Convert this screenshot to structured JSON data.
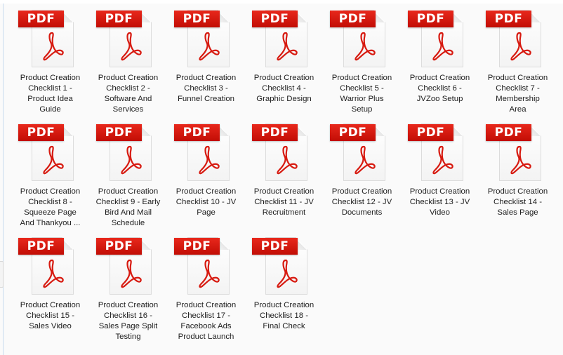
{
  "view": "large-icons",
  "file_icon": "pdf-file-icon",
  "icon_badge_text": "PDF",
  "colors": {
    "background": "#fafafa",
    "pdf_red": "#d71a10",
    "text": "#1e1e1e"
  },
  "files": [
    {
      "label_lines": [
        "Product Creation",
        "Checklist 1 -",
        "Product Idea",
        "Guide"
      ]
    },
    {
      "label_lines": [
        "Product Creation",
        "Checklist 2 -",
        "Software And",
        "Services"
      ]
    },
    {
      "label_lines": [
        "Product Creation",
        "Checklist 3 -",
        "Funnel Creation"
      ]
    },
    {
      "label_lines": [
        "Product Creation",
        "Checklist 4 -",
        "Graphic Design"
      ]
    },
    {
      "label_lines": [
        "Product Creation",
        "Checklist 5 -",
        "Warrior Plus",
        "Setup"
      ]
    },
    {
      "label_lines": [
        "Product Creation",
        "Checklist 6 -",
        "JVZoo Setup"
      ]
    },
    {
      "label_lines": [
        "Product Creation",
        "Checklist 7 -",
        "Membership",
        "Area"
      ]
    },
    {
      "label_lines": [
        "Product Creation",
        "Checklist 8 -",
        "Squeeze Page",
        "And Thankyou ..."
      ]
    },
    {
      "label_lines": [
        "Product Creation",
        "Checklist 9 - Early",
        "Bird And Mail",
        "Schedule"
      ]
    },
    {
      "label_lines": [
        "Product Creation",
        "Checklist 10 - JV",
        "Page"
      ]
    },
    {
      "label_lines": [
        "Product Creation",
        "Checklist 11 - JV",
        "Recruitment"
      ]
    },
    {
      "label_lines": [
        "Product Creation",
        "Checklist 12 - JV",
        "Documents"
      ]
    },
    {
      "label_lines": [
        "Product Creation",
        "Checklist 13 - JV",
        "Video"
      ]
    },
    {
      "label_lines": [
        "Product Creation",
        "Checklist 14 -",
        "Sales Page"
      ]
    },
    {
      "label_lines": [
        "Product Creation",
        "Checklist 15 -",
        "Sales Video"
      ]
    },
    {
      "label_lines": [
        "Product Creation",
        "Checklist 16 -",
        "Sales Page Split",
        "Testing"
      ]
    },
    {
      "label_lines": [
        "Product Creation",
        "Checklist 17 -",
        "Facebook Ads",
        "Product Launch"
      ]
    },
    {
      "label_lines": [
        "Product Creation",
        "Checklist 18 -",
        "Final Check"
      ]
    }
  ]
}
